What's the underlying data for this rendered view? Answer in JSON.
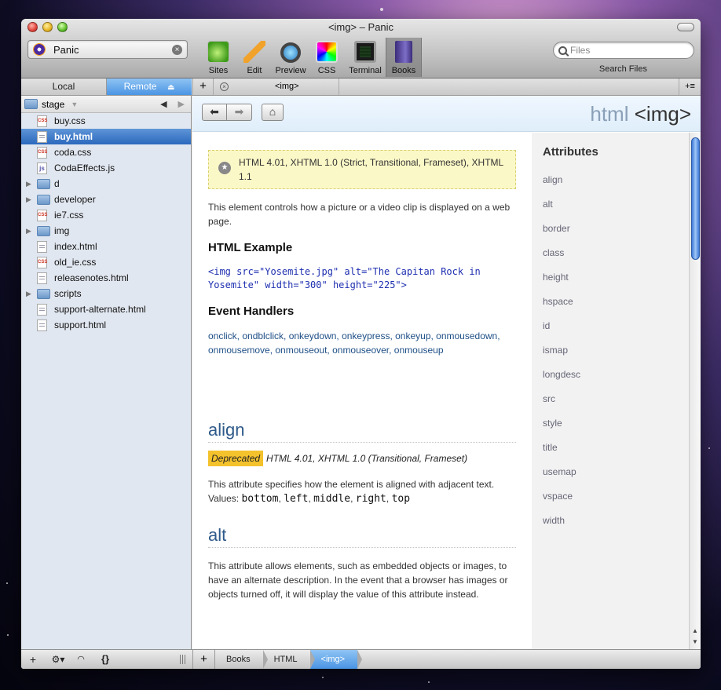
{
  "window": {
    "title": "<img> – Panic"
  },
  "site": {
    "name": "Panic"
  },
  "toolbar": {
    "tools": [
      {
        "label": "Sites",
        "icon": "leaf-icon"
      },
      {
        "label": "Edit",
        "icon": "pencil-icon"
      },
      {
        "label": "Preview",
        "icon": "magnifier-globe-icon"
      },
      {
        "label": "CSS",
        "icon": "color-wheel-icon"
      },
      {
        "label": "Terminal",
        "icon": "terminal-icon"
      },
      {
        "label": "Books",
        "icon": "book-icon"
      }
    ],
    "search_placeholder": "Files",
    "search_label": "Search Files"
  },
  "sidebar": {
    "tab_local": "Local",
    "tab_remote": "Remote",
    "remote_icon": "⏏",
    "folder": "stage",
    "files": [
      {
        "name": "buy.css",
        "type": "css"
      },
      {
        "name": "buy.html",
        "type": "html",
        "selected": true
      },
      {
        "name": "coda.css",
        "type": "css"
      },
      {
        "name": "CodaEffects.js",
        "type": "js"
      },
      {
        "name": "d",
        "type": "folder"
      },
      {
        "name": "developer",
        "type": "folder"
      },
      {
        "name": "ie7.css",
        "type": "css"
      },
      {
        "name": "img",
        "type": "folder"
      },
      {
        "name": "index.html",
        "type": "html"
      },
      {
        "name": "old_ie.css",
        "type": "css"
      },
      {
        "name": "releasenotes.html",
        "type": "html"
      },
      {
        "name": "scripts",
        "type": "folder"
      },
      {
        "name": "support-alternate.html",
        "type": "html"
      },
      {
        "name": "support.html",
        "type": "html"
      }
    ]
  },
  "tabs": {
    "open_tab": "<img>"
  },
  "page": {
    "lang": "html",
    "element": "<img>",
    "compat": "HTML 4.01, XHTML 1.0 (Strict, Transitional, Frameset), XHTML 1.1",
    "description": "This element controls how a picture or a video clip is displayed on a web page.",
    "example_heading": "HTML Example",
    "example_code": "<img src=\"Yosemite.jpg\" alt=\"The Capitan Rock in Yosemite\" width=\"300\" height=\"225\">",
    "events_heading": "Event Handlers",
    "events": "onclick, ondblclick, onkeydown, onkeypress, onkeyup, onmousedown, onmousemove, onmouseout, onmouseover, onmouseup",
    "align": {
      "title": "align",
      "badge": "Deprecated",
      "compat": "HTML 4.01, XHTML 1.0 (Transitional, Frameset)",
      "text": "This attribute specifies how the element is aligned with adjacent text.",
      "values_label": "Values:",
      "values": [
        "bottom",
        "left",
        "middle",
        "right",
        "top"
      ]
    },
    "alt": {
      "title": "alt",
      "text": "This attribute allows elements, such as embedded objects or images, to have an alternate description. In the event that a browser has images or objects turned off, it will display the value of this attribute instead."
    }
  },
  "attributes": {
    "heading": "Attributes",
    "items": [
      "align",
      "alt",
      "border",
      "class",
      "height",
      "hspace",
      "id",
      "ismap",
      "longdesc",
      "src",
      "style",
      "title",
      "usemap",
      "vspace",
      "width"
    ]
  },
  "breadcrumbs": [
    "Books",
    "HTML",
    "<img>"
  ]
}
